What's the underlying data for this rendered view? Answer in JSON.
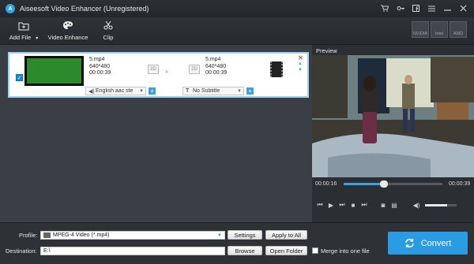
{
  "window": {
    "title": "Aiseesoft Video Enhancer (Unregistered)",
    "logo_letter": "A"
  },
  "titlebar_icons": [
    "cart-icon",
    "key-icon",
    "facebook-icon",
    "menu-icon",
    "minimize-icon",
    "close-icon"
  ],
  "toolbar": {
    "add_file_label": "Add File",
    "video_enhance_label": "Video Enhance",
    "clip_label": "Clip"
  },
  "hardware": [
    "NVIDIA",
    "Intel",
    "AMD"
  ],
  "file": {
    "source": {
      "name": "5.mp4",
      "resolution": "640*480",
      "duration": "00:00:39"
    },
    "output": {
      "name": "5.mp4",
      "resolution": "640*480",
      "duration": "00:00:39"
    },
    "badge_2d": "2D",
    "audio_track": "English aac ste",
    "subtitle": "No Subtitle",
    "checked": true
  },
  "preview": {
    "label": "Preview",
    "current_time": "00:00:16",
    "total_time": "00:00:39",
    "progress": 0.41,
    "volume": 0.7
  },
  "bottom": {
    "profile_label": "Profile:",
    "profile_value": "MPEG-4 Video (*.mp4)",
    "settings_label": "Settings",
    "apply_all_label": "Apply to All",
    "destination_label": "Destination:",
    "destination_value": "E:\\",
    "browse_label": "Browse",
    "open_folder_label": "Open Folder",
    "merge_label": "Merge into one file",
    "convert_label": "Convert"
  },
  "colors": {
    "accent": "#2b9be3",
    "titlebar": "#24272b",
    "panel": "#3a3e45"
  }
}
